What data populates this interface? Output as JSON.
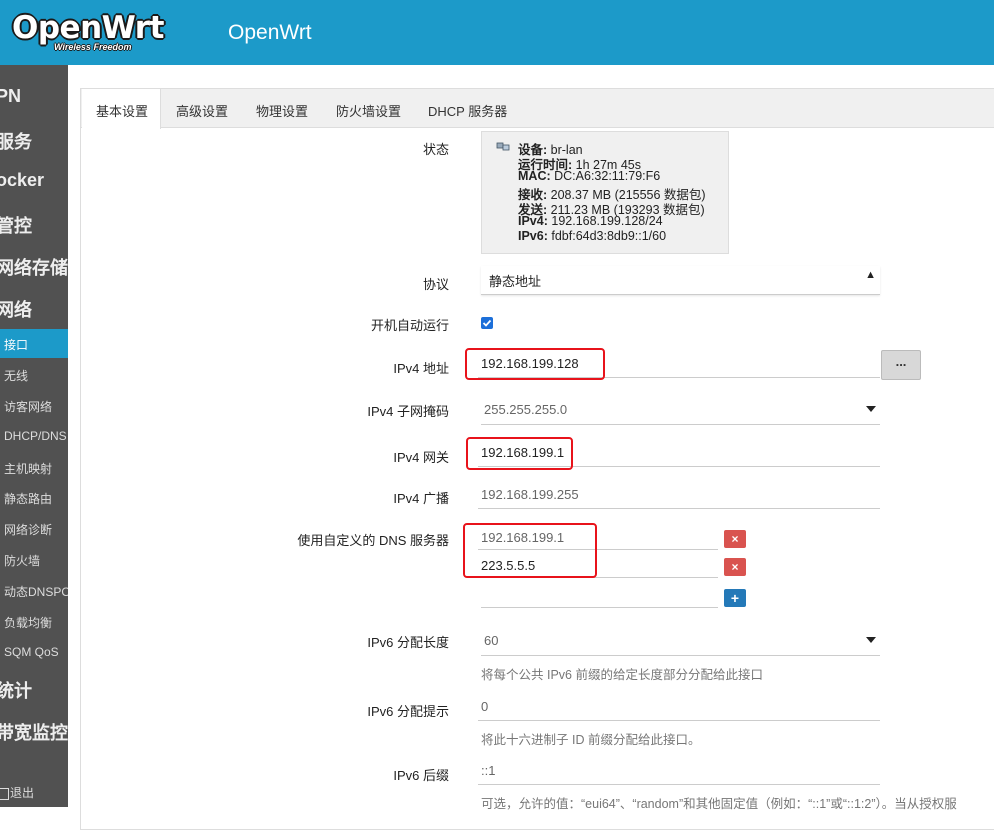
{
  "header": {
    "logo": "OpenWrt",
    "logo_tagline": "Wireless Freedom",
    "hostname": "OpenWrt"
  },
  "sidebar": {
    "main": [
      "PN",
      "服务",
      "ocker",
      "管控",
      "网络存储",
      "网络"
    ],
    "sub": [
      "接口",
      "无线",
      "访客网络",
      "DHCP/DNS",
      "主机映射",
      "静态路由",
      "网络诊断",
      "防火墙",
      "动态DNSPO",
      "负载均衡",
      "SQM QoS"
    ],
    "bottom": [
      "统计",
      "带宽监控"
    ],
    "logout": "退出"
  },
  "tabs": [
    "基本设置",
    "高级设置",
    "物理设置",
    "防火墙设置",
    "DHCP 服务器"
  ],
  "form": {
    "status_label": "状态",
    "status": {
      "device_k": "设备:",
      "device_v": "br-lan",
      "uptime_k": "运行时间:",
      "uptime_v": "1h 27m 45s",
      "mac_k": "MAC:",
      "mac_v": "DC:A6:32:11:79:F6",
      "rx_k": "接收:",
      "rx_v": "208.37 MB (215556 数据包)",
      "tx_k": "发送:",
      "tx_v": "211.23 MB (193293 数据包)",
      "ipv4_k": "IPv4:",
      "ipv4_v": "192.168.199.128/24",
      "ipv6_k": "IPv6:",
      "ipv6_v": "fdbf:64d3:8db9::1/60"
    },
    "protocol_label": "协议",
    "protocol_value": "静态地址",
    "autostart_label": "开机自动运行",
    "ipv4addr_label": "IPv4 地址",
    "ipv4addr_value": "192.168.199.128",
    "dots": "...",
    "netmask_label": "IPv4 子网掩码",
    "netmask_value": "255.255.255.0",
    "gateway_label": "IPv4 网关",
    "gateway_value": "192.168.199.1",
    "broadcast_label": "IPv4 广播",
    "broadcast_value": "192.168.199.255",
    "dns_label": "使用自定义的 DNS 服务器",
    "dns1": "192.168.199.1",
    "dns2": "223.5.5.5",
    "ip6len_label": "IPv6 分配长度",
    "ip6len_value": "60",
    "ip6len_hint": "将每个公共 IPv6 前缀的给定长度部分分配给此接口",
    "ip6hint_label": "IPv6 分配提示",
    "ip6hint_value": "0",
    "ip6hint_hint": "将此十六进制子 ID 前缀分配给此接口。",
    "ip6suffix_label": "IPv6 后缀",
    "ip6suffix_value": "::1",
    "ip6suffix_hint": "可选，允许的值：“eui64”、“random”和其他固定值（例如：“::1”或“::1:2”）。当从授权服"
  }
}
